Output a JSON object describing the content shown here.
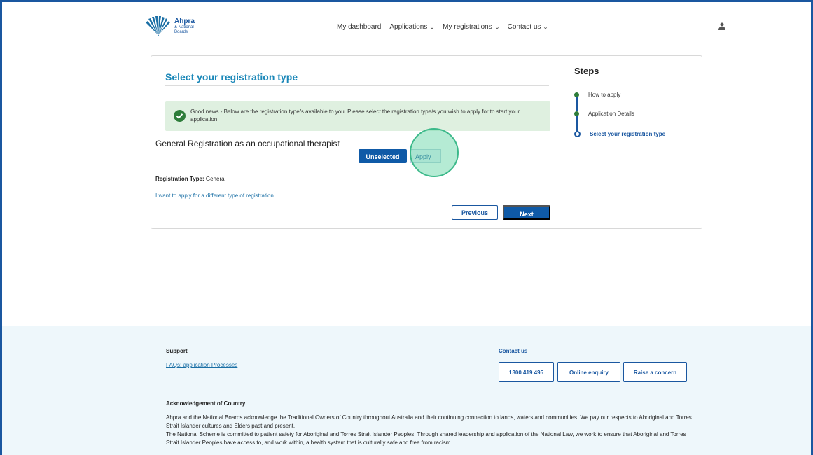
{
  "header": {
    "logo_main": "Ahpra",
    "logo_sub1": "& National",
    "logo_sub2": "Boards",
    "nav": [
      {
        "label": "My dashboard",
        "has_dropdown": false
      },
      {
        "label": "Applications",
        "has_dropdown": true
      },
      {
        "label": "My registrations",
        "has_dropdown": true
      },
      {
        "label": "Contact us",
        "has_dropdown": true
      }
    ],
    "user_icon": "user-icon"
  },
  "card": {
    "title": "Select your registration type",
    "alert_text": "Good news - Below are the registration type/s available to you. Please select the registration type/s you wish to apply for to start your application.",
    "registration_title": "General Registration as an occupational therapist",
    "unselected_label": "Unselected",
    "apply_label": "Apply",
    "reg_type_label": "Registration Type:",
    "reg_type_value": "General",
    "different_link": "I want to apply for a different type of registration.",
    "previous_label": "Previous",
    "next_label": "Next"
  },
  "steps": {
    "title": "Steps",
    "items": [
      {
        "label": "How to apply",
        "status": "complete"
      },
      {
        "label": "Application Details",
        "status": "complete"
      },
      {
        "label": "Select your registration type",
        "status": "current"
      }
    ]
  },
  "footer": {
    "support_title": "Support",
    "faq_link": "FAQs: application Processes",
    "contact_title": "Contact us",
    "phone_label": "1300 419 495",
    "enquiry_label": "Online enquiry",
    "concern_label": "Raise a concern",
    "ack_title": "Acknowledgement of Country",
    "ack_p1": "Ahpra and the National Boards acknowledge the Traditional Owners of Country throughout Australia and their continuing connection to lands, waters and communities. We pay our respects to Aboriginal and Torres Strait Islander cultures and Elders past and present.",
    "ack_p2": "The National Scheme is committed to patient safety for Aboriginal and Torres Strait Islander Peoples. Through shared leadership and application of the National Law, we work to ensure that Aboriginal and Torres Strait Islander Peoples have access to, and work within, a health system that is culturally safe and free from racism."
  },
  "colors": {
    "brand_blue": "#0f5aa7",
    "title_teal": "#1a87b8",
    "success_green": "#2e7d3a",
    "alert_bg": "#dff0e0",
    "footer_bg": "#eef7fb"
  }
}
